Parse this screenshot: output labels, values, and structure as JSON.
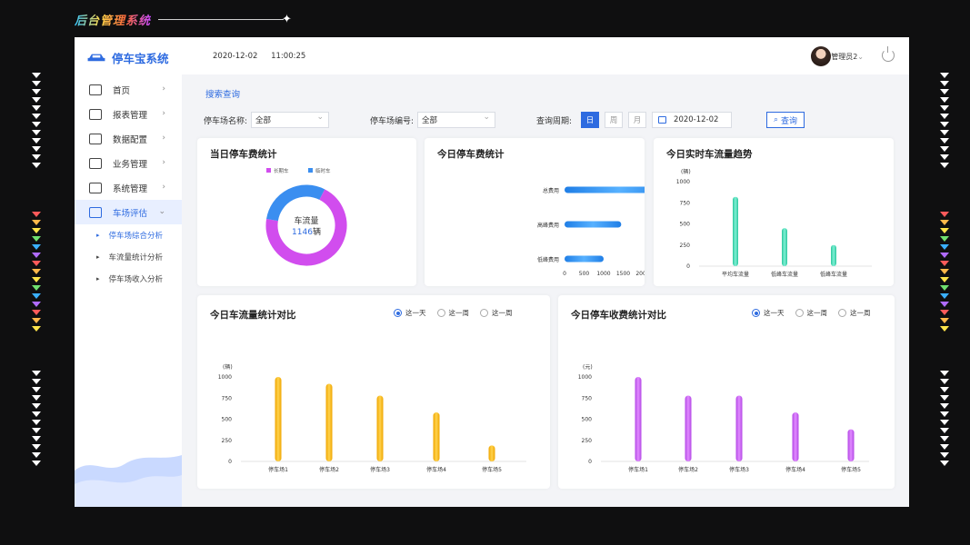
{
  "banner": {
    "title": "后台管理系统"
  },
  "app": {
    "name": "停车宝系统"
  },
  "topbar": {
    "date": "2020-12-02",
    "time": "11:00:25",
    "user": "管理员2"
  },
  "sidebar": {
    "items": [
      {
        "label": "首页",
        "icon": "home-icon",
        "chevron": "›"
      },
      {
        "label": "报表管理",
        "icon": "report-icon",
        "chevron": "›"
      },
      {
        "label": "数据配置",
        "icon": "data-config-icon",
        "chevron": "›"
      },
      {
        "label": "业务管理",
        "icon": "business-icon",
        "chevron": "›"
      },
      {
        "label": "系统管理",
        "icon": "system-icon",
        "chevron": "›"
      },
      {
        "label": "车场评估",
        "icon": "evaluate-icon",
        "chevron": "⌄",
        "active": true
      }
    ],
    "sub_items": [
      {
        "label": "停车场综合分析",
        "active": true
      },
      {
        "label": "车流量统计分析"
      },
      {
        "label": "停车场收入分析"
      }
    ]
  },
  "search": {
    "title": "搜索查询",
    "lot_name_label": "停车场名称:",
    "lot_name_value": "全部",
    "lot_code_label": "停车场编号:",
    "lot_code_value": "全部",
    "period_label": "查询周期:",
    "period_options": [
      "日",
      "周",
      "月"
    ],
    "period_selected": "日",
    "date_value": "2020-12-02",
    "query_button": "查询"
  },
  "colors": {
    "accent": "#2e6be0",
    "long_term": "#d14dee",
    "temporary": "#3a8ef0",
    "teal": "#3ed6b2",
    "orange": "#ffb300",
    "purple": "#c45ef0"
  },
  "cards": {
    "donut": {
      "title": "当日停车费统计",
      "legend": [
        "长期车",
        "临时车"
      ],
      "center_label": "车流量",
      "center_value": "1146",
      "center_unit": "辆"
    },
    "fee": {
      "title": "今日停车费统计"
    },
    "trend": {
      "title": "今日实时车流量趋势"
    },
    "flow_compare": {
      "title": "今日车流量统计对比",
      "radios": [
        "这一天",
        "这一周",
        "这一周"
      ]
    },
    "income_compare": {
      "title": "今日停车收费统计对比",
      "radios": [
        "这一天",
        "这一周",
        "这一周"
      ]
    }
  },
  "chart_data": [
    {
      "type": "pie",
      "title": "当日停车费统计",
      "categories": [
        "长期车",
        "临时车"
      ],
      "values": [
        70,
        30
      ],
      "annotation": "车流量 1146辆"
    },
    {
      "type": "bar",
      "orientation": "horizontal",
      "title": "今日停车费统计",
      "categories": [
        "总费用",
        "高峰费用",
        "低峰费用"
      ],
      "values": [
        2800,
        1450,
        1000
      ],
      "xticks": [
        "0",
        "500",
        "1000",
        "1500",
        "2000",
        "2500",
        "3000"
      ],
      "xlim": [
        0,
        3000
      ]
    },
    {
      "type": "bar",
      "title": "今日实时车流量趋势",
      "ylabel": "(辆)",
      "categories": [
        "平均车流量",
        "低峰车流量",
        "低峰车流量"
      ],
      "values": [
        820,
        450,
        250
      ],
      "yticks": [
        "1000",
        "750",
        "500",
        "250",
        "0"
      ],
      "ylim": [
        0,
        1000
      ]
    },
    {
      "type": "bar",
      "title": "今日车流量统计对比",
      "ylabel": "(辆)",
      "categories": [
        "停车场1",
        "停车场2",
        "停车场3",
        "停车场4",
        "停车场5"
      ],
      "values": [
        1000,
        920,
        780,
        580,
        190
      ],
      "yticks": [
        "1000",
        "750",
        "500",
        "250",
        "0"
      ],
      "ylim": [
        0,
        1000
      ]
    },
    {
      "type": "bar",
      "title": "今日停车收费统计对比",
      "ylabel": "(元)",
      "categories": [
        "停车场1",
        "停车场2",
        "停车场3",
        "停车场4",
        "停车场5"
      ],
      "values": [
        1000,
        780,
        780,
        580,
        380
      ],
      "yticks": [
        "1000",
        "750",
        "500",
        "250",
        "0"
      ],
      "ylim": [
        0,
        1000
      ]
    }
  ]
}
